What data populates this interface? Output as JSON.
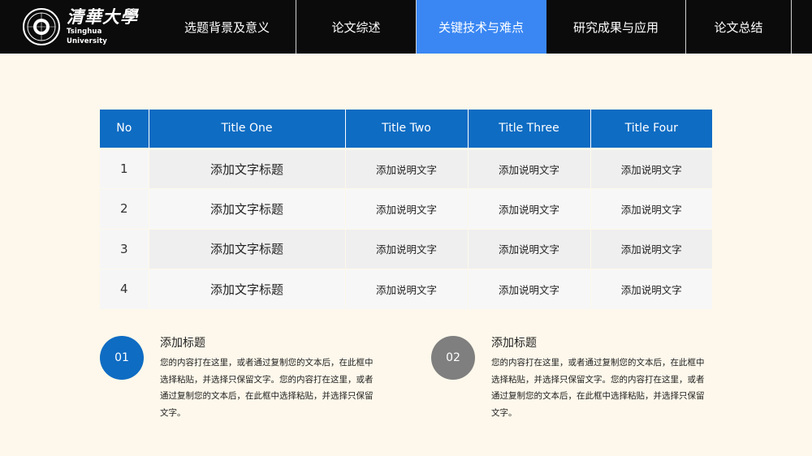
{
  "header": {
    "logo": {
      "cn": "清華大學",
      "en": "Tsinghua University"
    },
    "nav": [
      {
        "label": "选题背景及意义",
        "active": false
      },
      {
        "label": "论文综述",
        "active": false
      },
      {
        "label": "关键技术与难点",
        "active": true
      },
      {
        "label": "研究成果与应用",
        "active": false
      },
      {
        "label": "论文总结",
        "active": false
      }
    ]
  },
  "table": {
    "headers": [
      "No",
      "Title  One",
      "Title Two",
      "Title Three",
      "Title Four"
    ],
    "rows": [
      {
        "no": "1",
        "title": "添加文字标题",
        "c1": "添加说明文字",
        "c2": "添加说明文字",
        "c3": "添加说明文字"
      },
      {
        "no": "2",
        "title": "添加文字标题",
        "c1": "添加说明文字",
        "c2": "添加说明文字",
        "c3": "添加说明文字"
      },
      {
        "no": "3",
        "title": "添加文字标题",
        "c1": "添加说明文字",
        "c2": "添加说明文字",
        "c3": "添加说明文字"
      },
      {
        "no": "4",
        "title": "添加文字标题",
        "c1": "添加说明文字",
        "c2": "添加说明文字",
        "c3": "添加说明文字"
      }
    ]
  },
  "blocks": [
    {
      "number": "01",
      "title": "添加标题",
      "text": "您的内容打在这里，或者通过复制您的文本后，在此框中选择粘贴，并选择只保留文字。您的内容打在这里，或者通过复制您的文本后，在此框中选择粘贴，并选择只保留文字。",
      "color": "#0e6cc3"
    },
    {
      "number": "02",
      "title": "添加标题",
      "text": "您的内容打在这里，或者通过复制您的文本后，在此框中选择粘贴，并选择只保留文字。您的内容打在这里，或者通过复制您的文本后，在此框中选择粘贴，并选择只保留文字。",
      "color": "#7f7f7f"
    }
  ],
  "colors": {
    "background": "#fdf8eb",
    "topbar": "#0b0b0b",
    "nav_active": "#3a87f3",
    "table_header": "#0e6cc3"
  }
}
